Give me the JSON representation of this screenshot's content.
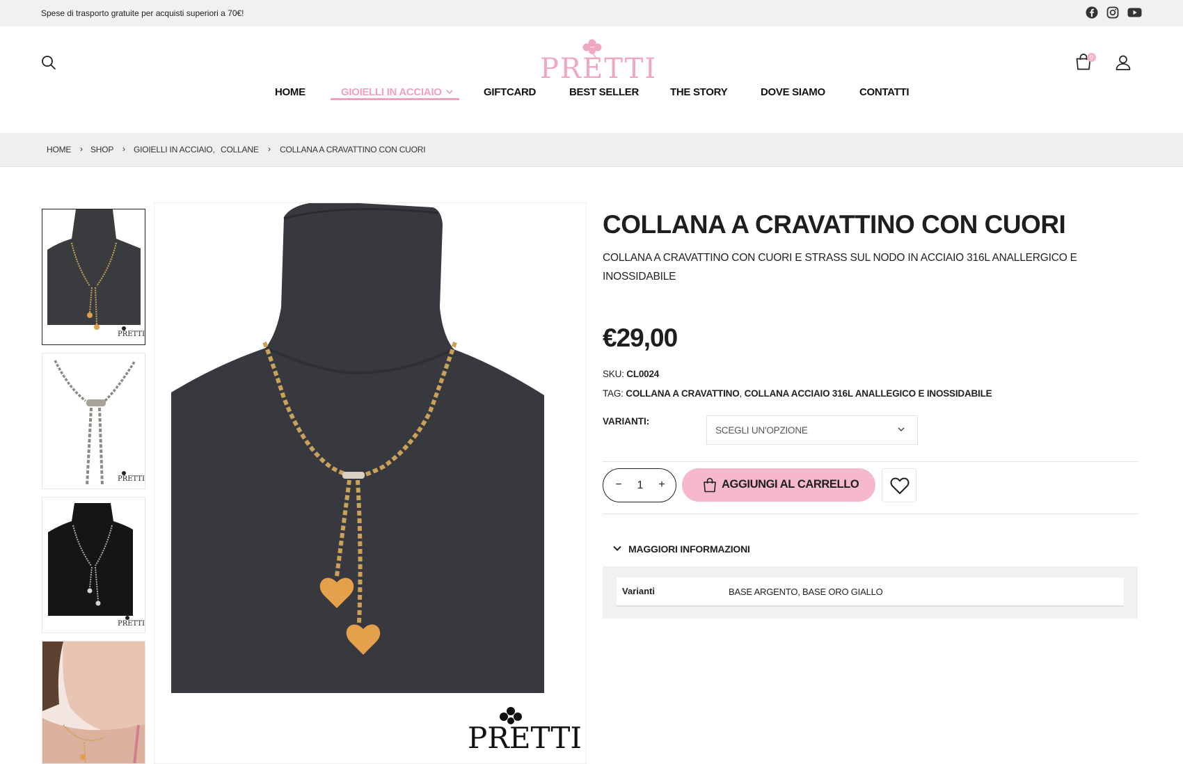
{
  "topbar": {
    "promo": "Spese di trasporto gratuite per acquisti superiori a 70€!",
    "social": [
      {
        "icon": "facebook-icon"
      },
      {
        "icon": "instagram-icon"
      },
      {
        "icon": "youtube-icon"
      }
    ]
  },
  "header": {
    "logo_text": "PRETTI",
    "cart_count": "0",
    "icons": {
      "search": "search-icon",
      "cart": "shopping-bag-icon",
      "account": "user-icon"
    }
  },
  "nav": {
    "items": [
      {
        "label": "HOME"
      },
      {
        "label": "GIOIELLI IN ACCIAIO",
        "active": true,
        "has_dropdown": true
      },
      {
        "label": "GIFTCARD"
      },
      {
        "label": "BEST SELLER"
      },
      {
        "label": "THE STORY"
      },
      {
        "label": "DOVE SIAMO"
      },
      {
        "label": "CONTATTI"
      }
    ],
    "active_color": "#f0a0bd"
  },
  "breadcrumb": {
    "home": "HOME",
    "shop": "SHOP",
    "category1": "GIOIELLI IN ACCIAIO,",
    "category2": "COLLANE",
    "current": "COLLANA A CRAVATTINO CON CUORI"
  },
  "product": {
    "title": "COLLANA A CRAVATTINO CON CUORI",
    "description": "COLLANA A CRAVATTINO  CON CUORI E STRASS SUL NODO IN ACCIAIO 316L ANALLERGICO E INOSSIDABILE",
    "price": "€29,00",
    "sku_label": "SKU:",
    "sku": "CL0024",
    "tag_label": "TAG:",
    "tag1": "COLLANA A CRAVATTINO",
    "tag_sep": ",",
    "tag2": "COLLANA ACCIAIO 316L ANALLEGICO E INOSSIDABILE",
    "variant_label": "VARIANTI:",
    "variant_placeholder": "SCEGLI UN'OPZIONE",
    "quantity": "1",
    "qty_minus": "−",
    "qty_plus": "+",
    "add_to_cart": "AGGIUNGI AL CARRELLO",
    "watermark": "PRETTI",
    "button_color": "#f6b8cc"
  },
  "more_info": {
    "label": "MAGGIORI INFORMAZIONI",
    "rows": [
      {
        "name": "Varianti",
        "value": "BASE ARGENTO, BASE ORO GIALLO"
      }
    ]
  }
}
